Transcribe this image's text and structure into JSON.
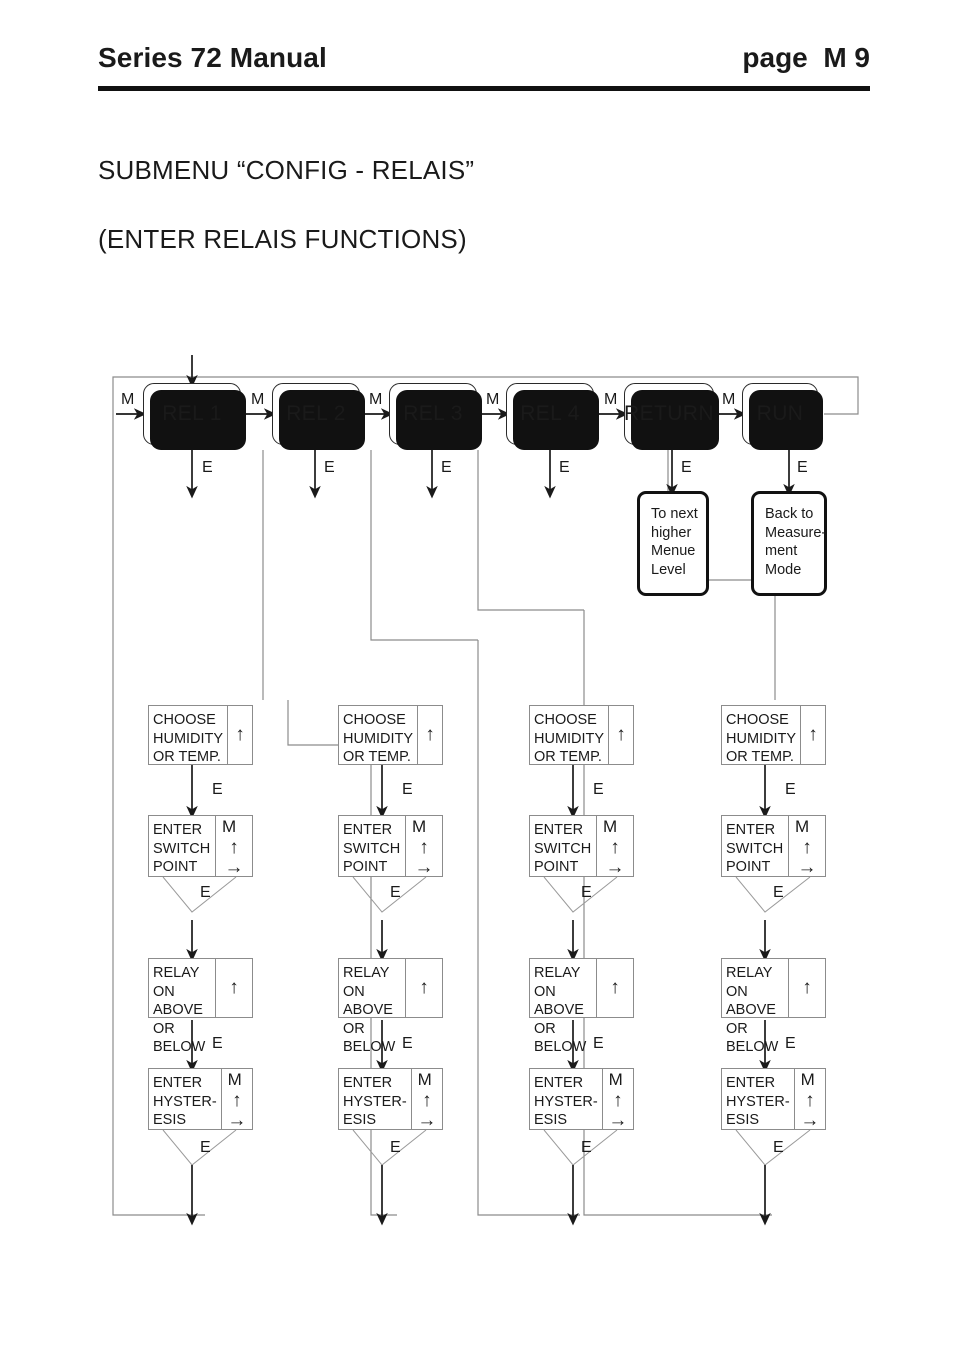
{
  "header": {
    "left_title": "Series 72 Manual",
    "right_title": "page  M 9"
  },
  "titles": {
    "line1": "SUBMENU “CONFIG - RELAIS”",
    "line2": "(ENTER RELAIS FUNCTIONS)"
  },
  "diagram": {
    "top_row": [
      {
        "label": "REL 1",
        "in_key": "M",
        "out_key": "E"
      },
      {
        "label": "REL 2",
        "in_key": "M",
        "out_key": "E"
      },
      {
        "label": "REL 3",
        "in_key": "M",
        "out_key": "E"
      },
      {
        "label": "REL 4",
        "in_key": "M",
        "out_key": "E"
      },
      {
        "label": "RETURN",
        "in_key": "M",
        "out_key": "E"
      },
      {
        "label": "RUN",
        "in_key": "M",
        "out_key": "E"
      }
    ],
    "terminals": [
      {
        "name": "to-next-higher-menue-level",
        "text": "To next\nhigher\nMenue\nLevel"
      },
      {
        "name": "back-to-measurement-mode",
        "text": "Back to\nMeasure-\nment\nMode"
      }
    ],
    "column_steps": [
      {
        "name": "choose-humidity-or-temp",
        "text": "CHOOSE\nHUMIDITY\nOR TEMP.",
        "keys": [
          "up"
        ],
        "next_key": "E"
      },
      {
        "name": "enter-switch-point",
        "text": "ENTER\nSWITCH\nPOINT",
        "keys": [
          "M",
          "up",
          "right"
        ],
        "next_key": "E"
      },
      {
        "name": "relay-on-above-or-below",
        "text": "RELAY\nON ABOVE\nOR BELOW",
        "keys": [
          "up"
        ],
        "next_key": "E"
      },
      {
        "name": "enter-hysteresis",
        "text": "ENTER\nHYSTER-\nESIS",
        "keys": [
          "M",
          "up",
          "right"
        ],
        "next_key": "E"
      }
    ],
    "columns": [
      {
        "name": "column-rel-1",
        "source": "REL 1"
      },
      {
        "name": "column-rel-2",
        "source": "REL 2"
      },
      {
        "name": "column-rel-3",
        "source": "REL 3"
      },
      {
        "name": "column-rel-4",
        "source": "REL 4"
      }
    ],
    "glyphs": {
      "up": "↑",
      "right": "→",
      "m": "M"
    },
    "colors": {
      "ink": "#1a1a1a",
      "wire": "#8c8c8c",
      "wire_dark": "#1a1a1a",
      "shadow": "#111111"
    }
  }
}
